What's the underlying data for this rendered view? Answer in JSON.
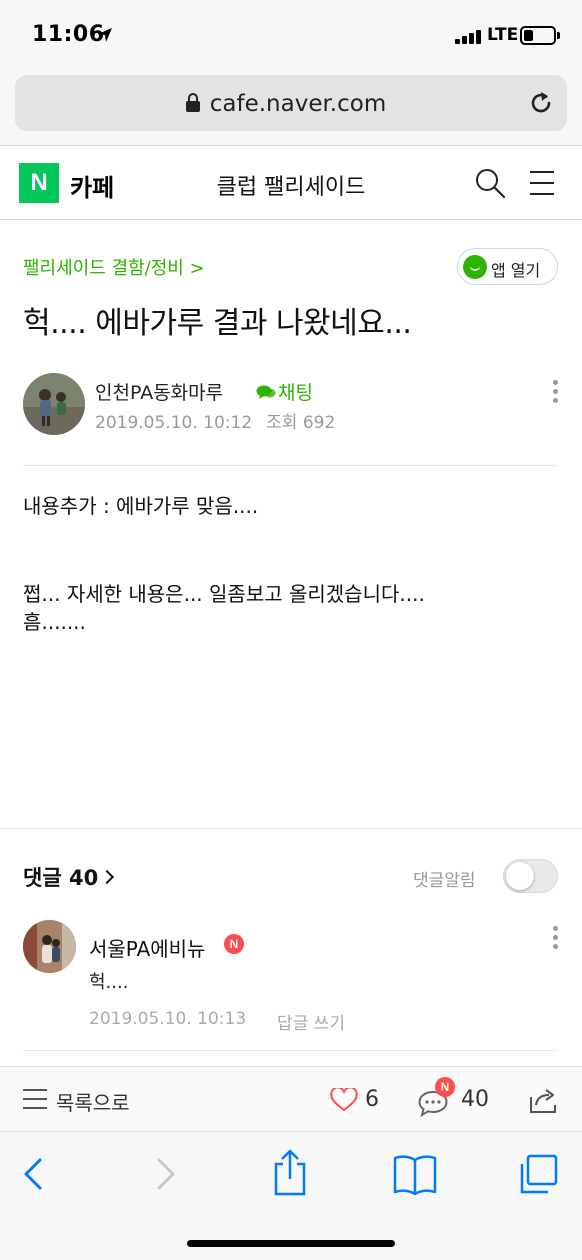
{
  "status_bar": {
    "time": "11:06",
    "network": "LTE",
    "location_icon": "location-arrow-icon",
    "battery_level": 0.2
  },
  "browser": {
    "url": "cafe.naver.com",
    "lock_icon": "lock-icon",
    "reload_icon": "reload-icon"
  },
  "cafe_header": {
    "logo": "N",
    "cafe_label": "카페",
    "club_name": "클럽 팰리세이드",
    "brand_color": "#03c75a"
  },
  "article": {
    "board": "팰리세이드 결함/정비 >",
    "app_open": "앱 열기",
    "title": "헉.... 에바가루 결과 나왔네요...",
    "author": "인천PA동화마루",
    "chat": "채팅",
    "date": "2019.05.10. 10:12",
    "views": "조회 692",
    "body": [
      "내용추가 : 에바가루 맞음....",
      "",
      "쩝... 자세한 내용은... 일좀보고 올리겠습니다....",
      "흠......."
    ]
  },
  "comments": {
    "header": "댓글 40",
    "notify_label": "댓글알림",
    "notify_on": false,
    "items": [
      {
        "author": "서울PA에비뉴",
        "badge": "N",
        "text": "헉....",
        "date": "2019.05.10. 10:13",
        "reply": "답글 쓰기"
      }
    ]
  },
  "article_bar": {
    "list_label": "목록으로",
    "likes": "6",
    "comment_badge": "N",
    "comments": "40"
  },
  "colors": {
    "accent_green": "#2db400",
    "badge_red": "#ff4b4b",
    "ios_blue": "#007aff"
  }
}
